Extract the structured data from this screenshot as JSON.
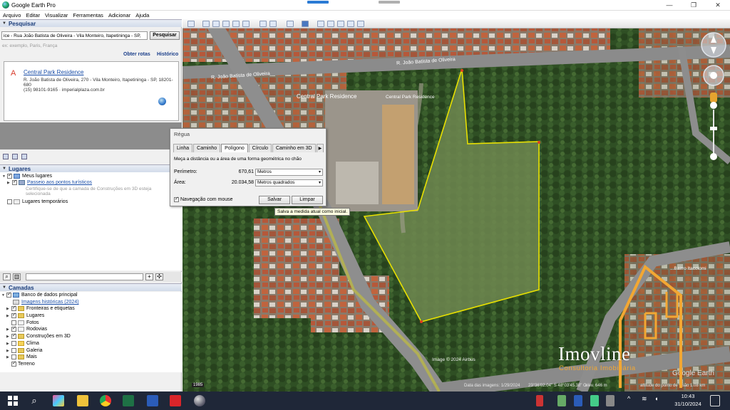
{
  "window": {
    "title": "Google Earth Pro"
  },
  "menu": [
    "Arquivo",
    "Editar",
    "Visualizar",
    "Ferramentas",
    "Adicionar",
    "Ajuda"
  ],
  "search": {
    "header": "Pesquisar",
    "value": "ice - Rua João Batista de Oliveira - Vila Monteiro, Itapetininga - SP,",
    "button": "Pesquisar",
    "hint": "ex: exemplo, Paris, França",
    "get_routes": "Obter rotas",
    "history": "Histórico"
  },
  "result": {
    "letter": "A",
    "name": "Central Park Residence",
    "address": "R. João Batista de Oliveira, 270 - Vila Monteiro, Itapetininga - SP, 18201-680",
    "phone_site": "(15) 98101-9165 · imperialplaza.com.br"
  },
  "places": {
    "header": "Lugares",
    "my_places": "Meus lugares",
    "tour": "Passeio aos pontos turísticos",
    "tour_note": "Certifique-se de que a camada de Construções em 3D esteja selecionada",
    "temp_places": "Lugares temporários"
  },
  "layers": {
    "header": "Camadas",
    "items": [
      {
        "label": "Banco de dados principal",
        "checked": true
      },
      {
        "label": "Imagens históricas (2024)",
        "checked": false,
        "link": true
      },
      {
        "label": "Fronteiras e etiquetas",
        "checked": true
      },
      {
        "label": "Lugares",
        "checked": true
      },
      {
        "label": "Fotos",
        "checked": false
      },
      {
        "label": "Rodovias",
        "checked": true
      },
      {
        "label": "Construções em 3D",
        "checked": true
      },
      {
        "label": "Clima",
        "checked": false
      },
      {
        "label": "Galeria",
        "checked": false
      },
      {
        "label": "Mais",
        "checked": false
      },
      {
        "label": "Terreno",
        "checked": true
      }
    ]
  },
  "ruler": {
    "title": "Régua",
    "tabs": [
      "Linha",
      "Caminho",
      "Polígono",
      "Círculo",
      "Caminho em 3D"
    ],
    "selected_tab": "Polígono",
    "description": "Meça a distância ou a área de uma forma geométrica no chão",
    "perimeter_label": "Perímetro:",
    "perimeter_value": "670,61",
    "perimeter_unit": "Metros",
    "area_label": "Área:",
    "area_value": "20.034,58",
    "area_unit": "Metros quadrados",
    "nav_mouse": "Navegação com mouse",
    "save": "Salvar",
    "clear": "Limpar",
    "tooltip": "Salva a medida atual como inicial."
  },
  "map": {
    "street_label_1": "R. João Batista de Oliveira",
    "street_label_2": "R. João Batista de Oliveira",
    "place_label_1": "Central Park Residence",
    "place_label_2": "Central Park Residence",
    "place_label_3": "...Bairro Itacolomi",
    "credit": "Image © 2024 Airbus",
    "watermark": "Google Earth",
    "year": "1985",
    "status_date": "Data das imagens: 1/29/2024",
    "status_coords": "23°36'02.04\" S  48°03'45.38\" O",
    "status_elev": "elev. 646 m",
    "status_alt": "altitude do ponto de visão 1.08 km",
    "polygon_color": "#e8e000"
  },
  "brand": {
    "name": "Imovline",
    "tagline": "Consultoria Imobiliária",
    "accent": "#f2a733"
  },
  "taskbar": {
    "time": "10:43",
    "date": "31/10/2024"
  }
}
